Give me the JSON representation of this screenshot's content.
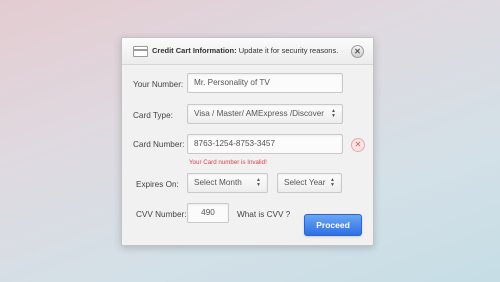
{
  "dialog": {
    "header": {
      "title": "Credit Cart Information:",
      "subtitle": "Update it for security reasons.",
      "close_glyph": "✕",
      "card_icon": "credit-card-icon"
    },
    "your_number": {
      "label": "Your Number:",
      "value": "Mr. Personality of TV"
    },
    "card_type": {
      "label": "Card Type:",
      "value": "Visa / Master/ AMExpress /Discover"
    },
    "card_number": {
      "label": "Card Number:",
      "value": "8763-1254-8753-3457",
      "error": "Your Card number is Invalid!",
      "error_glyph": "✕"
    },
    "expires": {
      "label": "Expires On:",
      "month_value": "Select Month",
      "year_value": "Select Year"
    },
    "cvv": {
      "label": "CVV Number:",
      "value": "490",
      "help": "What is CVV ?"
    },
    "proceed_label": "Proceed",
    "colors": {
      "accent": "#3a78e6",
      "error": "#d9454b"
    }
  }
}
